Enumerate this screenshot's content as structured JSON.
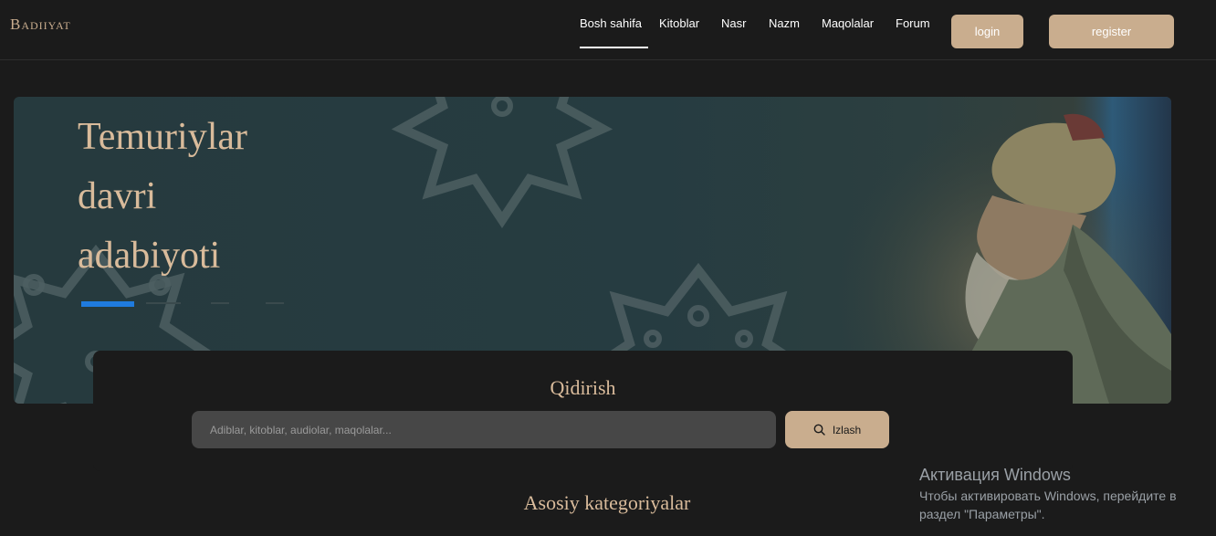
{
  "header": {
    "logo": "Badiiyat",
    "nav": [
      {
        "label": "Bosh sahifa",
        "active": true
      },
      {
        "label": "Kitoblar",
        "active": false
      },
      {
        "label": "Nasr",
        "active": false
      },
      {
        "label": "Nazm",
        "active": false
      },
      {
        "label": "Maqolalar",
        "active": false
      },
      {
        "label": "Forum",
        "active": false
      }
    ],
    "login_label": "login",
    "register_label": "register"
  },
  "hero": {
    "title_lines": [
      "Temuriylar",
      "davri",
      "adabiyoti"
    ],
    "slides_count": 4,
    "active_slide": 1
  },
  "search": {
    "title": "Qidirish",
    "placeholder": "Adiblar, kitoblar, audiolar, maqolalar...",
    "button_label": "Izlash",
    "button_icon": "search-icon"
  },
  "section": {
    "title": "Asosiy kategoriyalar"
  },
  "watermark": {
    "line1": "Активация Windows",
    "line2": "Чтобы активировать Windows, перейдите в раздел \"Параметры\"."
  },
  "colors": {
    "background": "#1b1b1b",
    "accent": "#c9ad8e",
    "heading": "#d9bb9b",
    "slider_active": "#1f7bde",
    "hero_bg": "#263c41"
  }
}
